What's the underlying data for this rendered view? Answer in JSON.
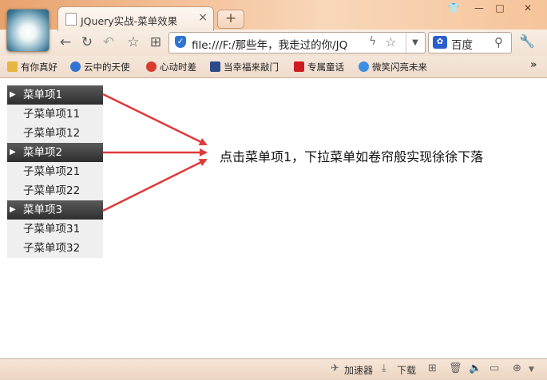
{
  "browser": {
    "tab_title": "JQuery实战-菜单效果",
    "tab_close": "×",
    "new_tab": "+",
    "window_controls": {
      "skin": "👕",
      "minimize": "—",
      "maximize": "□",
      "close": "✕"
    },
    "url": "file:///F:/那些年，我走过的你/JQ",
    "search_engine": "百度",
    "bookmarks": [
      "有你真好",
      "云中的天使",
      "心动时差",
      "当幸福来敲门",
      "专属童话",
      "微笑闪亮未来"
    ],
    "bookmarks_more": "»",
    "status": {
      "accelerator": "加速器",
      "download": "下载"
    }
  },
  "menu": [
    {
      "label": "菜单项1",
      "items": [
        "子菜单项11",
        "子菜单项12"
      ]
    },
    {
      "label": "菜单项2",
      "items": [
        "子菜单项21",
        "子菜单项22"
      ]
    },
    {
      "label": "菜单项3",
      "items": [
        "子菜单项31",
        "子菜单项32"
      ]
    }
  ],
  "caption": "点击菜单项1，下拉菜单如卷帘般实现徐徐下落",
  "colors": {
    "arrow": "#e0383a",
    "menu_head": "#3b3b3b",
    "menu_sub": "#efefef"
  },
  "icons": [
    "back-icon",
    "refresh-icon",
    "undo-icon",
    "bookmark-star-icon",
    "apps-icon",
    "shield-icon",
    "bolt-icon",
    "search-icon",
    "wrench-icon"
  ]
}
